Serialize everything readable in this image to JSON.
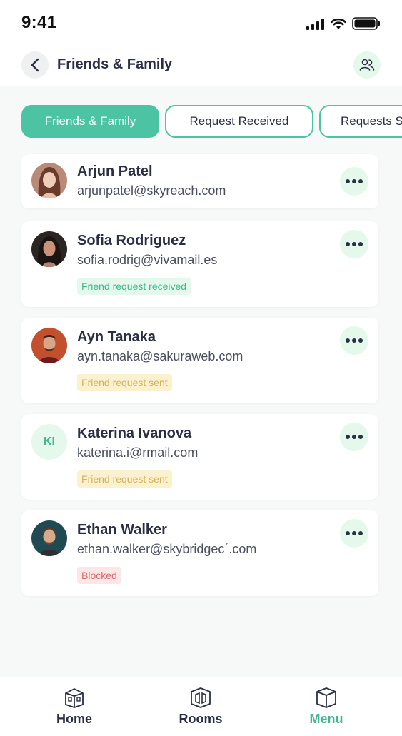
{
  "status": {
    "time": "9:41"
  },
  "header": {
    "title": "Friends & Family"
  },
  "tabs": [
    {
      "label": "Friends & Family",
      "active": true
    },
    {
      "label": "Request Received",
      "active": false
    },
    {
      "label": "Requests S",
      "active": false
    }
  ],
  "contacts": [
    {
      "name": "Arjun Patel",
      "email": "arjunpatel@skyreach.com",
      "badge": "",
      "initials": ""
    },
    {
      "name": "Sofia Rodriguez",
      "email": "sofia.rodrig@vivamail.es",
      "badge": "Friend request received",
      "badge_color": "green"
    },
    {
      "name": "Ayn Tanaka",
      "email": "ayn.tanaka@sakuraweb.com",
      "badge": "Friend request sent",
      "badge_color": "yellow"
    },
    {
      "name": "Katerina Ivanova",
      "email": "katerina.i@rmail.com",
      "badge": "Friend request sent",
      "badge_color": "yellow",
      "initials": "KI"
    },
    {
      "name": "Ethan Walker",
      "email": "ethan.walker@skybridgec´.com",
      "badge": "Blocked",
      "badge_color": "red"
    }
  ],
  "nav": [
    {
      "label": "Home",
      "icon": "home-icon",
      "active": false
    },
    {
      "label": "Rooms",
      "icon": "rooms-icon",
      "active": false
    },
    {
      "label": "Menu",
      "icon": "menu-cube-icon",
      "active": true
    }
  ],
  "colors": {
    "accent": "#4cc4a3",
    "text": "#2a2f45",
    "green_badge": "#e5f8ec",
    "yellow_badge": "#fbf1cf",
    "red_badge": "#fde6e6"
  }
}
